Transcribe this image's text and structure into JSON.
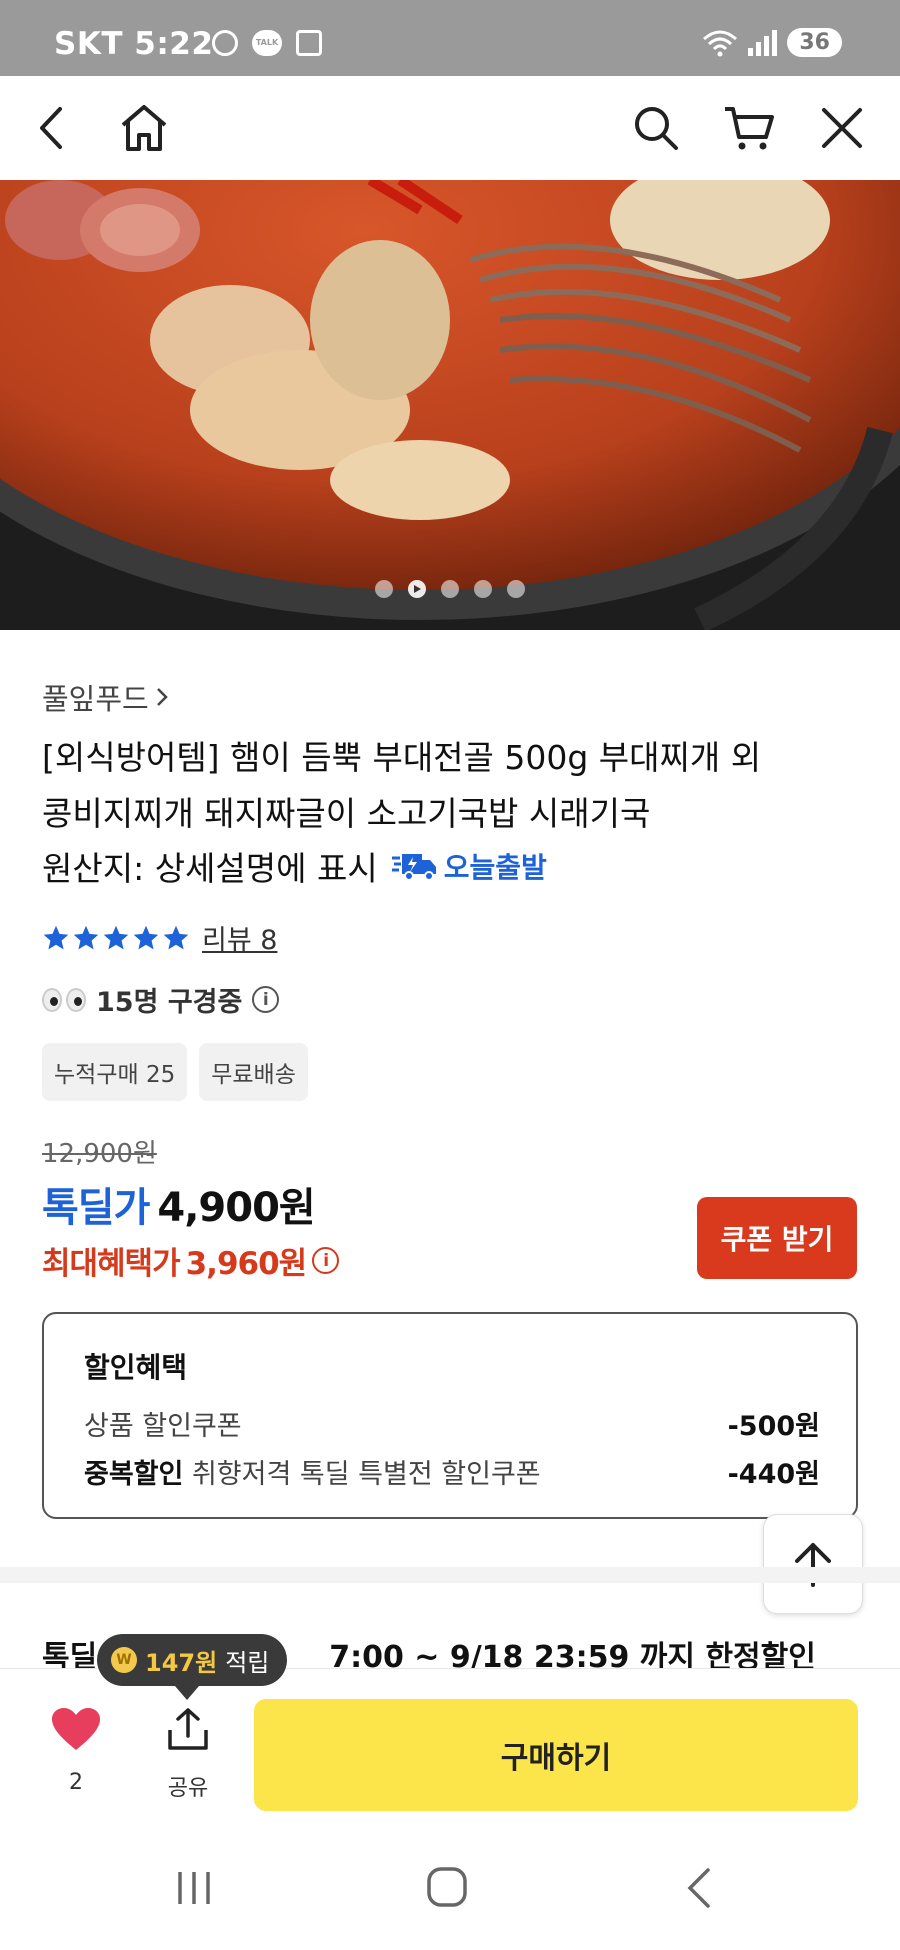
{
  "status_bar": {
    "carrier": "SKT",
    "time": "5:22",
    "talk": "TALK",
    "battery": "36"
  },
  "nav": {
    "icons": [
      "back-icon",
      "home-icon",
      "search-icon",
      "cart-icon",
      "close-icon"
    ]
  },
  "hero": {
    "slide_count": 5,
    "active_slide": 2
  },
  "product": {
    "brand": "풀잎푸드",
    "title_line1": "[외식방어템] 햄이 듬뿍 부대전골 500g 부대찌개 외",
    "title_line2": "콩비지찌개 돼지짜글이 소고기국밥 시래기국",
    "origin": "원산지: 상세설명에 표시",
    "today_ship": "오늘출발",
    "rating_stars": 5,
    "review_label": "리뷰 8",
    "viewers": "15명 구경중",
    "chips": [
      "누적구매 25",
      "무료배송"
    ]
  },
  "price": {
    "original": "12,900원",
    "deal_label": "톡딜가",
    "deal_price": "4,900원",
    "max_label": "최대혜택가",
    "max_price": "3,960원",
    "coupon_button": "쿠폰 받기"
  },
  "discount": {
    "title": "할인혜택",
    "rows": [
      {
        "prefix": "",
        "label": "상품 할인쿠폰",
        "amount": "-500원"
      },
      {
        "prefix": "중복할인",
        "label": "취향저격 톡딜 특별전 할인쿠폰",
        "amount": "-440원"
      }
    ]
  },
  "deal_time": {
    "prefix": "톡딜",
    "suffix": "7:00 ~ 9/18 23:59 까지 한정할인"
  },
  "bottom": {
    "points_amount": "147원",
    "points_label": "적립",
    "like_count": "2",
    "share_label": "공유",
    "buy_button": "구매하기"
  },
  "colors": {
    "accent_blue": "#1e62d8",
    "accent_red": "#d93a1e",
    "buy_yellow": "#fce54a"
  }
}
